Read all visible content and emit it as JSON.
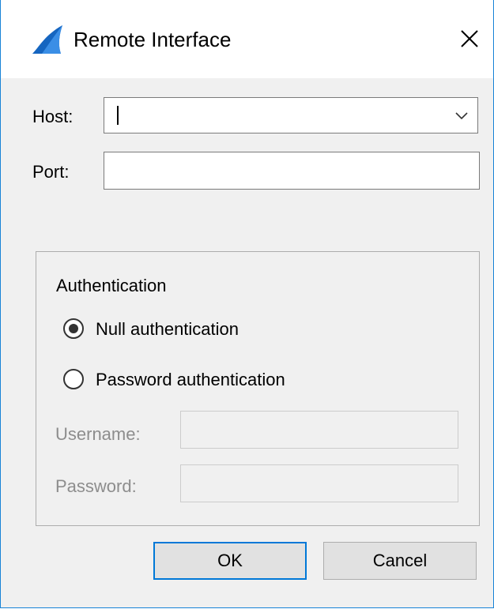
{
  "window": {
    "title": "Remote Interface",
    "icon": "shark-fin-icon",
    "close_icon": "close-icon",
    "accent_color": "#1883d7"
  },
  "form": {
    "host_label": "Host:",
    "host_value": "",
    "port_label": "Port:",
    "port_value": ""
  },
  "authentication": {
    "group_title": "Authentication",
    "options": [
      {
        "label": "Null authentication",
        "selected": true
      },
      {
        "label": "Password authentication",
        "selected": false
      }
    ],
    "username_label": "Username:",
    "username_value": "",
    "password_label": "Password:",
    "password_value": ""
  },
  "buttons": {
    "ok_label": "OK",
    "cancel_label": "Cancel"
  }
}
